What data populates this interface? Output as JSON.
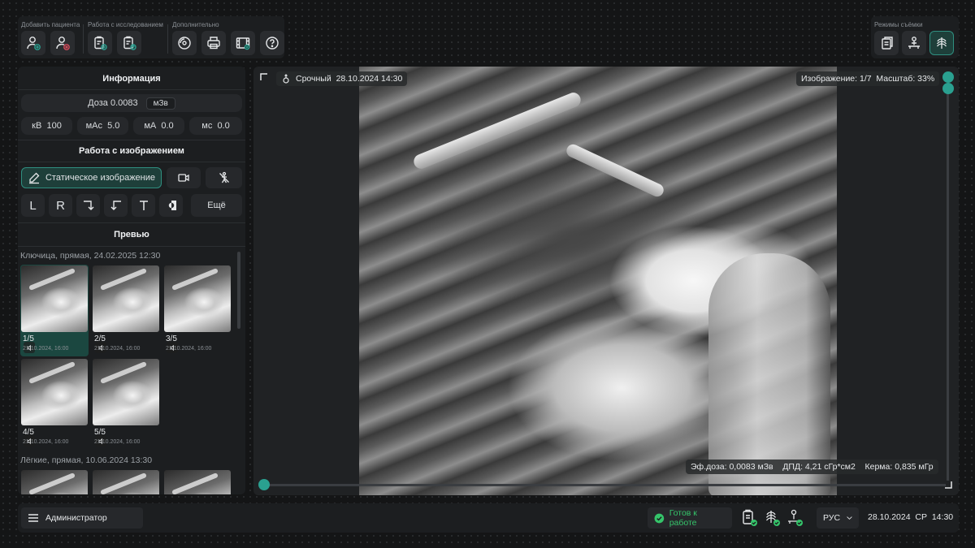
{
  "toolbar": {
    "groups": [
      {
        "title": "Добавить пациента",
        "buttons": [
          "add-patient-icon",
          "remove-patient-icon"
        ]
      },
      {
        "title": "Работа с исследованием",
        "buttons": [
          "add-study-icon",
          "export-study-icon"
        ]
      },
      {
        "title": "Дополнительно",
        "buttons": [
          "disc-icon",
          "print-icon",
          "film-icon",
          "help-icon"
        ]
      }
    ],
    "modes_title": "Режимы съёмки",
    "modes": [
      "protocol-icon",
      "patient-table-icon",
      "chest-xray-icon"
    ]
  },
  "info": {
    "title": "Информация",
    "dose_label": "Доза",
    "dose_value": "0.0083",
    "dose_unit": "мЗв",
    "params": [
      {
        "label": "кВ",
        "value": "100"
      },
      {
        "label": "мАс",
        "value": "5.0"
      },
      {
        "label": "мА",
        "value": "0.0"
      },
      {
        "label": "мс",
        "value": "0.0"
      }
    ]
  },
  "image_work": {
    "title": "Работа с изображением",
    "static_label": "Статическое изображение",
    "markers": [
      "L",
      "R"
    ],
    "more_label": "Ещё"
  },
  "preview": {
    "title": "Превью",
    "studies": [
      {
        "title": "Ключица, прямая, 24.02.2025 12:30",
        "items": [
          {
            "num": "1/5",
            "date": "21.10.2024, 16:00"
          },
          {
            "num": "2/5",
            "date": "21.10.2024, 16:00"
          },
          {
            "num": "3/5",
            "date": "21.10.2024, 16:00"
          },
          {
            "num": "4/5",
            "date": "21.10.2024, 16:00"
          },
          {
            "num": "5/5",
            "date": "21.10.2024, 16:00"
          }
        ]
      },
      {
        "title": "Лёгкие, прямая, 10.06.2024 13:30"
      }
    ]
  },
  "viewer": {
    "priority": "Срочный",
    "date": "28.10.2024",
    "time": "14:30",
    "image_counter": "Изображение: 1/7",
    "scale": "Масштаб: 33%",
    "eff_dose": "Эф.доза: 0,0083 мЗв",
    "dap": "ДПД: 4,21 сГр*см2",
    "kerma": "Керма: 0,835 мГр"
  },
  "statusbar": {
    "user": "Администратор",
    "status": "Готов к работе",
    "language": "РУС",
    "date": "28.10.2024",
    "weekday": "СР",
    "time": "14:30"
  },
  "colors": {
    "accent": "#2aa090",
    "ok": "#35c46a",
    "panel": "#1c1e20"
  }
}
